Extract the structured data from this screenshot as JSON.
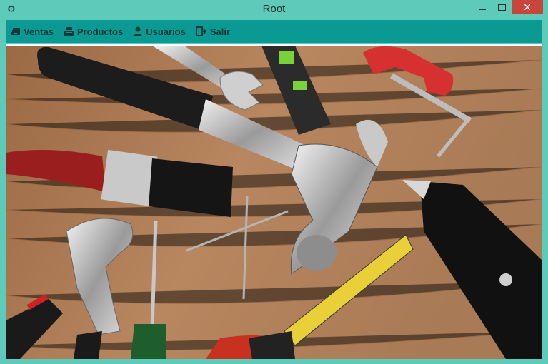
{
  "window": {
    "title": "Root",
    "app_icon": "gear-icon",
    "controls": {
      "minimize": "minimize-icon",
      "maximize": "maximize-icon",
      "close": "close-icon"
    }
  },
  "menu": {
    "items": [
      {
        "label": "Ventas",
        "icon": "money-stack-icon"
      },
      {
        "label": "Productos",
        "icon": "boxes-icon"
      },
      {
        "label": "Usuarios",
        "icon": "user-icon"
      },
      {
        "label": "Salir",
        "icon": "exit-icon"
      }
    ]
  },
  "colors": {
    "frame": "#5ecbba",
    "menubar": "#0a9a93",
    "menu_text": "#0c3b39",
    "close_button": "#c7453a"
  },
  "content": {
    "image": "tools-on-wooden-table-photo"
  }
}
